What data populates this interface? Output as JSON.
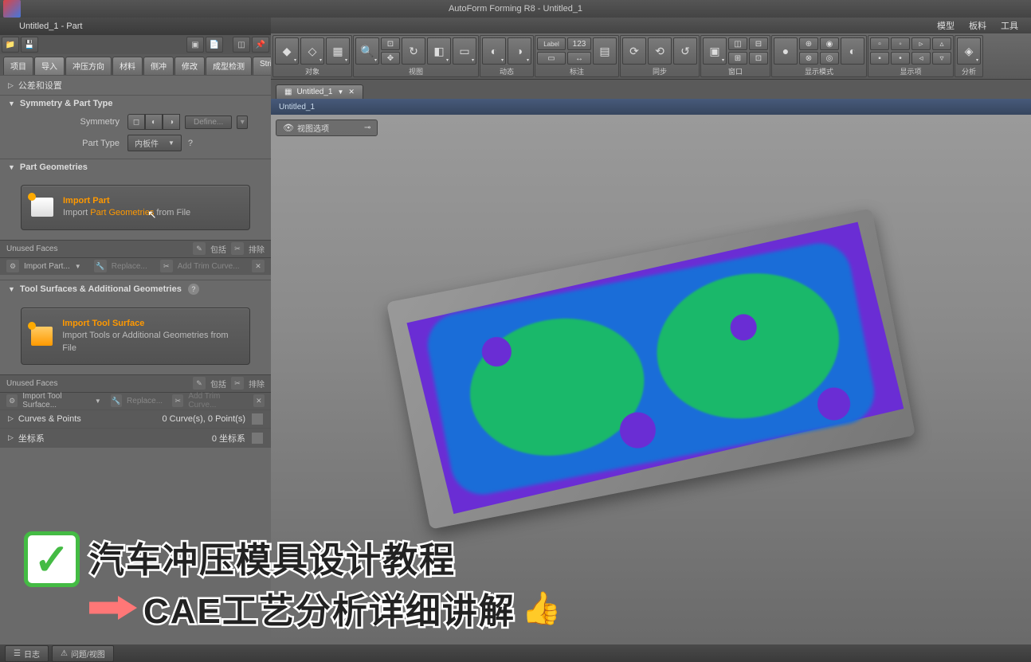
{
  "app": {
    "title": "AutoForm Forming R8 - Untitled_1"
  },
  "sidebar": {
    "header": "Untitled_1 - Part",
    "tabs": [
      "项目",
      "导入",
      "冲压方向",
      "材料",
      "侧冲",
      "修改",
      "成型检测",
      "Strip"
    ],
    "active_tab": 1,
    "row_settings": "公差和设置",
    "section_sym": "Symmetry & Part Type",
    "symmetry_label": "Symmetry",
    "symmetry_define": "Define...",
    "parttype_label": "Part Type",
    "parttype_value": "内板件",
    "section_geom": "Part Geometries",
    "import_part_title": "Import Part",
    "import_part_prefix": "Import ",
    "import_part_hl": "Part Geometries",
    "import_part_suffix": " from File",
    "unused_faces": "Unused Faces",
    "strip_include": "包括",
    "strip_exclude": "排除",
    "import_part_dd": "Import Part...",
    "replace": "Replace...",
    "add_trim": "Add Trim Curve...",
    "section_tool": "Tool Surfaces & Additional Geometries",
    "import_tool_title": "Import Tool Surface",
    "import_tool_desc": "Import Tools or Additional Geometries from File",
    "import_tool_dd": "Import Tool Surface...",
    "curves_points": "Curves & Points",
    "curves_points_val": "0 Curve(s), 0 Point(s)",
    "coord": "坐标系",
    "coord_val": "0 坐标系"
  },
  "top_menu": [
    "模型",
    "板料",
    "工具"
  ],
  "ribbon_groups": [
    "对象",
    "视图",
    "动态",
    "标注",
    "同步",
    "窗口",
    "显示模式",
    "显示项",
    "分析"
  ],
  "doc_tab": {
    "name": "Untitled_1"
  },
  "breadcrumb": "Untitled_1",
  "view_toolbar": "视图选项",
  "overlay": {
    "line1": "汽车冲压模具设计教程",
    "line2": "CAE工艺分析详细讲解"
  },
  "status": {
    "log": "日志",
    "problems": "问题/视图"
  }
}
